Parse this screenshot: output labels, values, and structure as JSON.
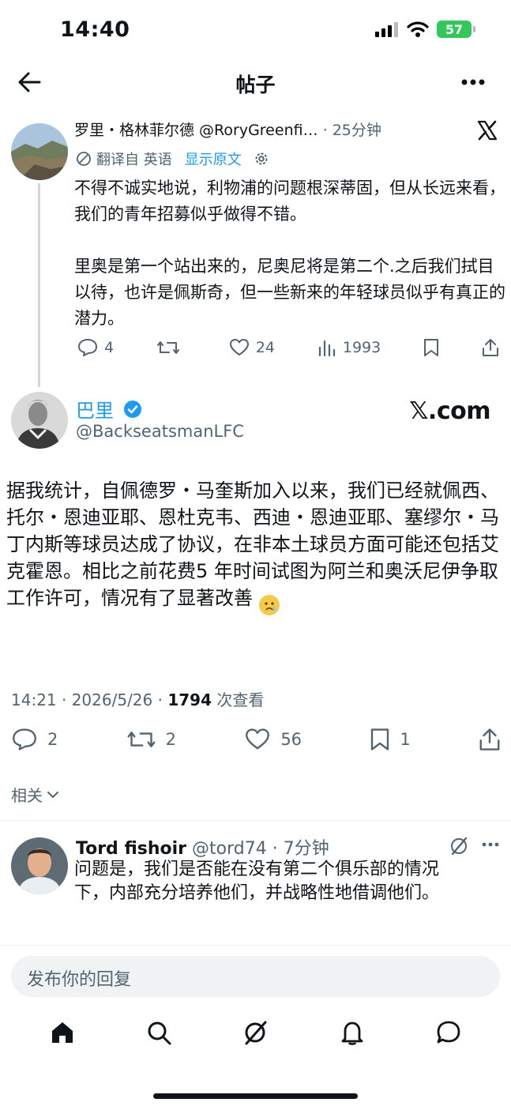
{
  "status_bar": {
    "time": "14:40",
    "battery": "57"
  },
  "nav": {
    "title": "帖子"
  },
  "quoted": {
    "author": "罗里・格林菲尔德 @RoryGreenfi…",
    "time": "· 25分钟",
    "translated_from": "翻译自 英语",
    "show_original": "显示原文",
    "text": "不得不诚实地说，利物浦的问题根深蒂固，但从长远来看，我们的青年招募似乎做得不错。\n\n里奥是第一个站出来的，尼奥尼将是第二个.之后我们拭目以待，也许是佩斯奇，但一些新来的年轻球员似乎有真正的潜力。",
    "replies": "4",
    "retweets": "",
    "likes": "24",
    "views": "1993"
  },
  "main": {
    "name": "巴里",
    "handle": "@BackseatsmanLFC",
    "watermark": "𝕏.com",
    "text": "据我统计，自佩德罗・马奎斯加入以来，我们已经就佩西、托尔・恩迪亚耶、恩杜克韦、西迪・恩迪亚耶、塞缪尔・马丁内斯等球员达成了协议，在非本土球员方面可能还包括艾克霍恩。相比之前花费5 年时间试图为阿兰和奥沃尼伊争取工作许可，情况有了显著改善",
    "time": "14:21 · 2026/5/26 · ",
    "views_count": "1794",
    "views_label": " 次查看",
    "replies": "2",
    "retweets": "2",
    "likes": "56",
    "bookmarks": "1"
  },
  "related_label": "相关",
  "reply": {
    "name": "Tord fishoir",
    "meta": " @tord74 · 7分钟",
    "text": "问题是，我们是否能在没有第二个俱乐部的情况下，内部充分培养他们，并战略性地借调他们。"
  },
  "compose": {
    "placeholder": "发布你的回复"
  },
  "colors": {
    "accent": "#1d9bf0",
    "text": "#0f1419",
    "muted": "#536471"
  }
}
